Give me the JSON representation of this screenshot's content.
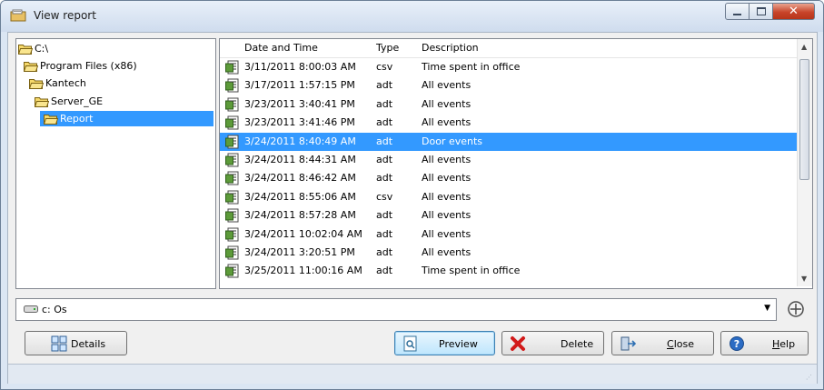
{
  "window": {
    "title": "View report",
    "minimize_icon": "minimize-icon",
    "maximize_icon": "maximize-icon",
    "close_icon": "close-icon"
  },
  "tree": {
    "items": [
      {
        "label": "C:\\",
        "icon": "folder-open-icon",
        "selected": false
      },
      {
        "label": "Program Files (x86)",
        "icon": "folder-open-icon",
        "selected": false
      },
      {
        "label": "Kantech",
        "icon": "folder-open-icon",
        "selected": false
      },
      {
        "label": "Server_GE",
        "icon": "folder-open-icon",
        "selected": false
      },
      {
        "label": "Report",
        "icon": "folder-open-icon",
        "selected": true
      }
    ]
  },
  "list": {
    "columns": [
      "Date and Time",
      "Type",
      "Description"
    ],
    "rows": [
      {
        "datetime": "3/11/2011 8:00:03 AM",
        "type": "csv",
        "description": "Time spent in office",
        "selected": false
      },
      {
        "datetime": "3/17/2011 1:57:15 PM",
        "type": "adt",
        "description": "All events",
        "selected": false
      },
      {
        "datetime": "3/23/2011 3:40:41 PM",
        "type": "adt",
        "description": "All events",
        "selected": false
      },
      {
        "datetime": "3/23/2011 3:41:46 PM",
        "type": "adt",
        "description": "All events",
        "selected": false
      },
      {
        "datetime": "3/24/2011 8:40:49 AM",
        "type": "adt",
        "description": "Door events",
        "selected": true
      },
      {
        "datetime": "3/24/2011 8:44:31 AM",
        "type": "adt",
        "description": "All events",
        "selected": false
      },
      {
        "datetime": "3/24/2011 8:46:42 AM",
        "type": "adt",
        "description": "All events",
        "selected": false
      },
      {
        "datetime": "3/24/2011 8:55:06 AM",
        "type": "csv",
        "description": "All events",
        "selected": false
      },
      {
        "datetime": "3/24/2011 8:57:28 AM",
        "type": "adt",
        "description": "All events",
        "selected": false
      },
      {
        "datetime": "3/24/2011 10:02:04 AM",
        "type": "adt",
        "description": "All events",
        "selected": false
      },
      {
        "datetime": "3/24/2011 3:20:51 PM",
        "type": "adt",
        "description": "All events",
        "selected": false
      },
      {
        "datetime": "3/25/2011 11:00:16 AM",
        "type": "adt",
        "description": "Time spent in office",
        "selected": false
      }
    ],
    "row_icon": "report-file-icon"
  },
  "drive": {
    "value": "c: Os",
    "icon": "drive-icon",
    "dropdown_icon": "dropdown-arrow-icon",
    "refresh_icon": "refresh-icon"
  },
  "buttons": {
    "details": "Details",
    "preview": "Preview",
    "delete": "Delete",
    "close_prefix": "",
    "close_mnemonic": "C",
    "close_rest": "lose",
    "help_mnemonic": "H",
    "help_rest": "elp"
  },
  "colors": {
    "selection": "#3399ff",
    "window_frame": "#dbe6f3",
    "close_button": "#c8452b"
  }
}
